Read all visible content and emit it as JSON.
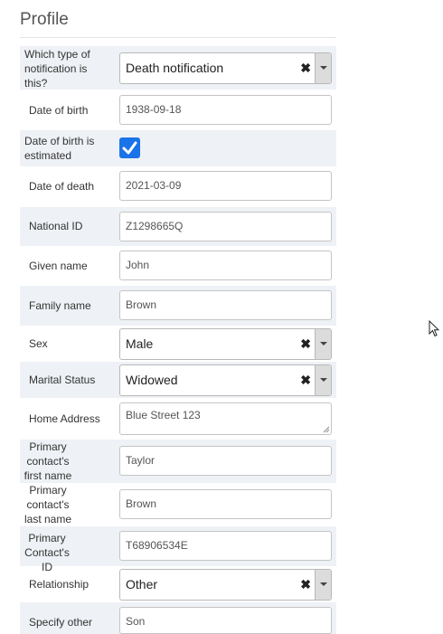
{
  "page": {
    "title": "Profile"
  },
  "fields": {
    "notification_type": {
      "label": "Which type of notification is this?",
      "value": "Death notification"
    },
    "date_of_birth": {
      "label": "Date of birth",
      "value": "1938-09-18"
    },
    "dob_estimated": {
      "label": "Date of birth is estimated",
      "checked": true
    },
    "date_of_death": {
      "label": "Date of death",
      "value": "2021-03-09"
    },
    "national_id": {
      "label": "National ID",
      "value": "Z1298665Q"
    },
    "given_name": {
      "label": "Given name",
      "value": "John"
    },
    "family_name": {
      "label": "Family name",
      "value": "Brown"
    },
    "sex": {
      "label": "Sex",
      "value": "Male"
    },
    "marital_status": {
      "label": "Marital Status",
      "value": "Widowed"
    },
    "home_address": {
      "label": "Home Address",
      "value": "Blue Street 123"
    },
    "primary_first_name": {
      "label": "Primary contact's first name",
      "value": "Taylor"
    },
    "primary_last_name": {
      "label": "Primary contact's last name",
      "value": "Brown"
    },
    "primary_id": {
      "label": "Primary Contact's ID",
      "value": "T68906534E"
    },
    "relationship": {
      "label": "Relationship",
      "value": "Other"
    },
    "specify_other": {
      "label": "Specify other",
      "value": "Son"
    }
  },
  "controls": {
    "clear_glyph": "✖"
  },
  "icons": {
    "checkmark": "check-icon",
    "dropdown": "chevron-down-icon",
    "cursor": "mouse-pointer-icon"
  },
  "colors": {
    "row_shade": "#eef1f5",
    "checkbox": "#1a73e8"
  }
}
